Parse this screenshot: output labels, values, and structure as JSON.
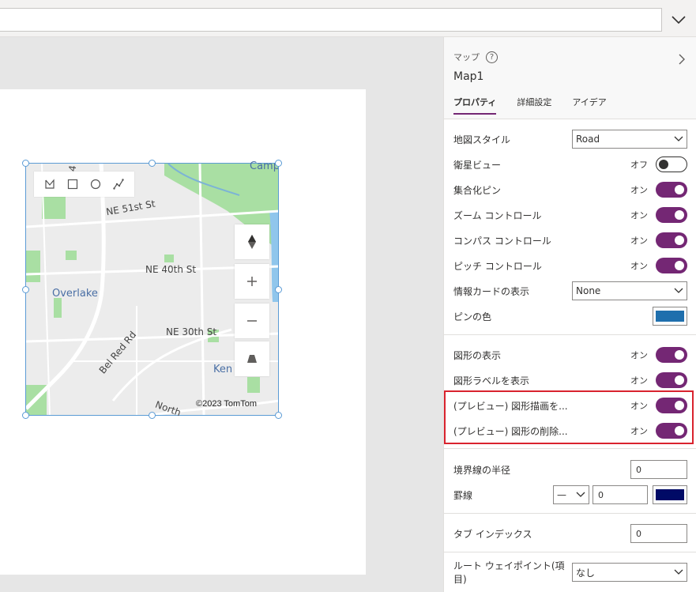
{
  "formula_bar": {
    "value": "",
    "expand_icon": "chevron-down-icon"
  },
  "map": {
    "labels": {
      "ne51": "NE 51st St",
      "ne40": "NE 40th St",
      "ne30": "NE 30th St",
      "overlake": "Overlake",
      "belred": "Bel Red Rd",
      "ken": "Ken",
      "camp": "Camp",
      "north": "North",
      "four": "4"
    },
    "copyright": "©2023 TomTom",
    "draw_tools": [
      "polygon-icon",
      "rectangle-icon",
      "circle-icon",
      "polyline-icon"
    ],
    "controls": [
      "compass-icon",
      "zoom-in-icon",
      "zoom-out-icon",
      "pitch-icon"
    ],
    "colors": {
      "park": "#a9dfa3",
      "water": "#90c6ec",
      "road": "#ffffff",
      "land": "#ececec"
    }
  },
  "panel": {
    "control_type": "マップ",
    "control_name": "Map1",
    "tabs": [
      "プロパティ",
      "詳細設定",
      "アイデア"
    ],
    "rows": {
      "map_style": {
        "label": "地図スタイル",
        "value": "Road"
      },
      "satellite": {
        "label": "衛星ビュー",
        "state": "オフ"
      },
      "cluster": {
        "label": "集合化ピン",
        "state": "オン"
      },
      "zoom": {
        "label": "ズーム コントロール",
        "state": "オン"
      },
      "compass": {
        "label": "コンパス コントロール",
        "state": "オン"
      },
      "pitch": {
        "label": "ピッチ コントロール",
        "state": "オン"
      },
      "info_card": {
        "label": "情報カードの表示",
        "value": "None"
      },
      "pin_color": {
        "label": "ピンの色",
        "color": "#1f6fad"
      },
      "show_shapes": {
        "label": "図形の表示",
        "state": "オン"
      },
      "shape_labels": {
        "label": "図形ラベルを表示",
        "state": "オン"
      },
      "preview_draw": {
        "label": "(プレビュー) 図形描画を...",
        "state": "オン"
      },
      "preview_delete": {
        "label": "(プレビュー) 図形の削除...",
        "state": "オン"
      },
      "border_radius": {
        "label": "境界線の半径",
        "value": "0"
      },
      "border": {
        "label": "罫線",
        "style": "—",
        "width": "0",
        "color": "#000a66"
      },
      "tab_index": {
        "label": "タブ インデックス",
        "value": "0"
      },
      "route_waypoints": {
        "label": "ルート ウェイポイント(項目)",
        "value": "なし"
      }
    }
  },
  "accent": "#742774",
  "highlight": "#d9232e"
}
